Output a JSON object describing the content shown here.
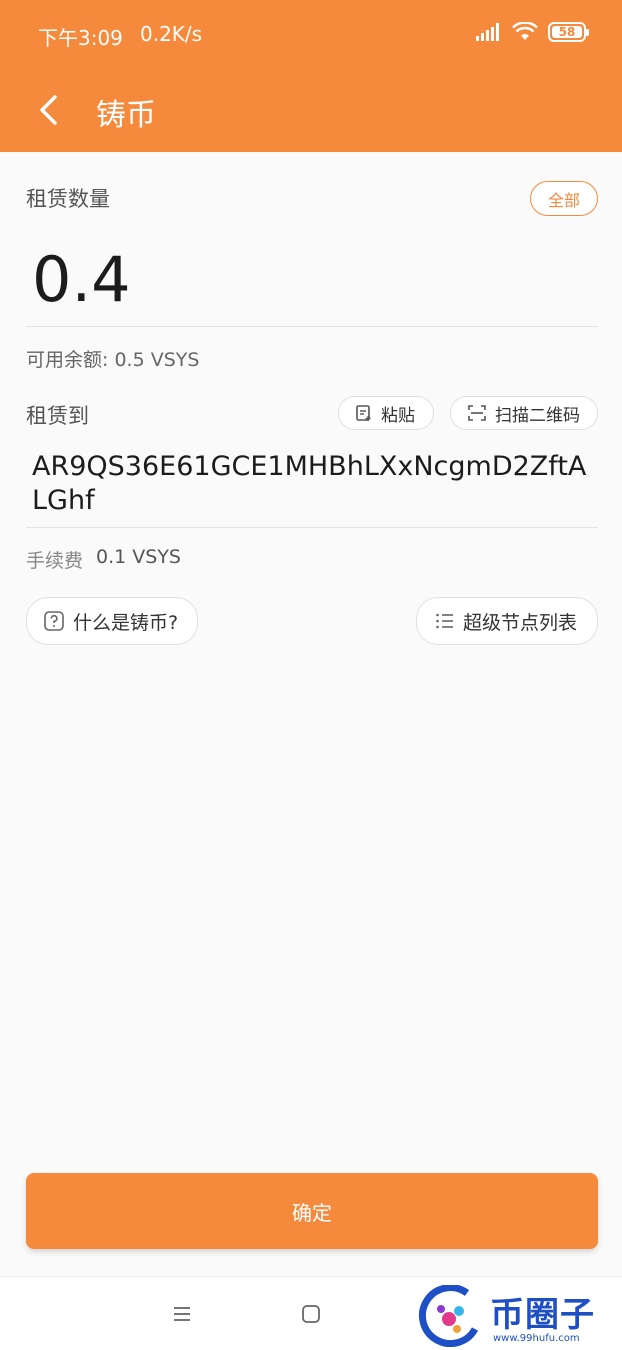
{
  "status_bar": {
    "time": "下午3:09",
    "speed": "0.2K/s",
    "battery": "58"
  },
  "nav": {
    "back_icon": "chevron-left-icon",
    "title": "铸币"
  },
  "lease": {
    "amount_label": "租赁数量",
    "all_button": "全部",
    "amount_value": "0.4",
    "available_balance": "可用余额: 0.5 VSYS"
  },
  "recipient": {
    "label": "租赁到",
    "paste_button": "粘贴",
    "scan_button": "扫描二维码",
    "address": "AR9QS36E61GCE1MHBhLXxNcgmD2ZftALGhf"
  },
  "fee": {
    "label": "手续费",
    "value": "0.1 VSYS"
  },
  "links": {
    "what_is_minting": "什么是铸币?",
    "supernode_list": "超级节点列表"
  },
  "confirm_button": "确定",
  "watermark": {
    "text": "币圈子",
    "url": "www.99hufu.com"
  },
  "colors": {
    "accent": "#f58a3c",
    "background": "#fbfafa"
  }
}
